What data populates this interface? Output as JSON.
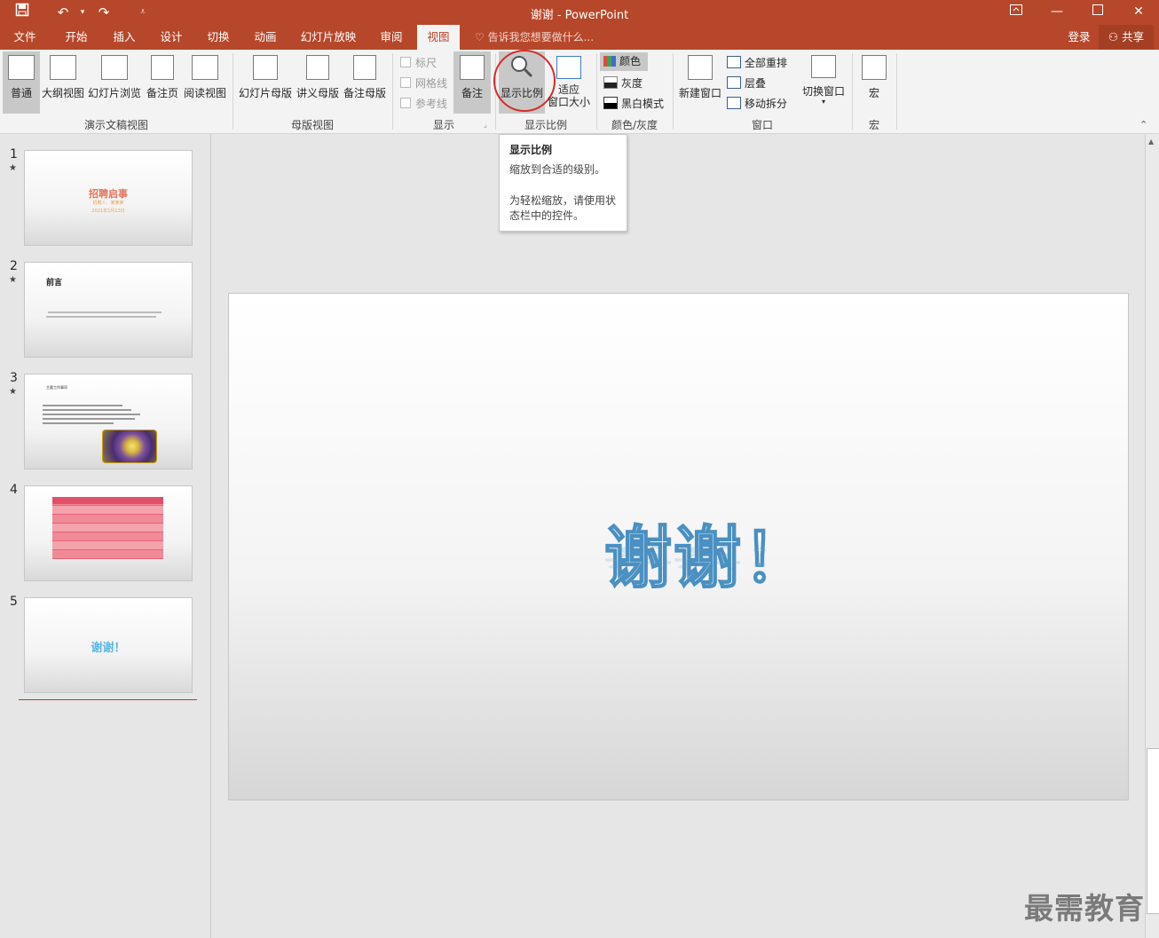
{
  "window": {
    "title": "谢谢 - PowerPoint",
    "qat": {
      "save_icon": "save-icon",
      "undo_icon": "undo-icon",
      "redo_icon": "redo-icon"
    }
  },
  "tabs": [
    "文件",
    "开始",
    "插入",
    "设计",
    "切换",
    "动画",
    "幻灯片放映",
    "审阅",
    "视图"
  ],
  "active_tab": "视图",
  "tellme": "告诉我您想要做什么...",
  "account": {
    "login": "登录",
    "share": "共享"
  },
  "ribbon": {
    "presentation_views": {
      "label": "演示文稿视图",
      "buttons": [
        "普通",
        "大纲视图",
        "幻灯片浏览",
        "备注页",
        "阅读视图"
      ]
    },
    "master_views": {
      "label": "母版视图",
      "buttons": [
        "幻灯片母版",
        "讲义母版",
        "备注母版"
      ]
    },
    "show": {
      "label": "显示",
      "checks": [
        "标尺",
        "网格线",
        "参考线"
      ],
      "notes": "备注"
    },
    "zoom": {
      "label": "显示比例",
      "zoom_btn": "显示比例",
      "fit_line1": "适应",
      "fit_line2": "窗口大小"
    },
    "color": {
      "label": "颜色/灰度",
      "items": [
        "颜色",
        "灰度",
        "黑白模式"
      ]
    },
    "window": {
      "label": "窗口",
      "new_window": "新建窗口",
      "arrange_all": "全部重排",
      "cascade": "层叠",
      "move_split": "移动拆分",
      "switch": "切换窗口"
    },
    "macro": {
      "label": "宏",
      "btn": "宏"
    }
  },
  "tooltip": {
    "title": "显示比例",
    "line1": "缩放到合适的级别。",
    "line2": "为轻松缩放，请使用状",
    "line3": "态栏中的控件。"
  },
  "slides": [
    {
      "num": "1",
      "star": "★",
      "title": "招聘启事",
      "sub": "招聘人：某某某",
      "date": "2021年1月13日"
    },
    {
      "num": "2",
      "star": "★",
      "title": "前言"
    },
    {
      "num": "3",
      "star": "★",
      "title": "主要工作事项"
    },
    {
      "num": "4",
      "star": ""
    },
    {
      "num": "5",
      "star": "",
      "title": "谢谢！"
    }
  ],
  "main_slide": {
    "text": "谢谢！"
  },
  "watermark": "最需教育"
}
